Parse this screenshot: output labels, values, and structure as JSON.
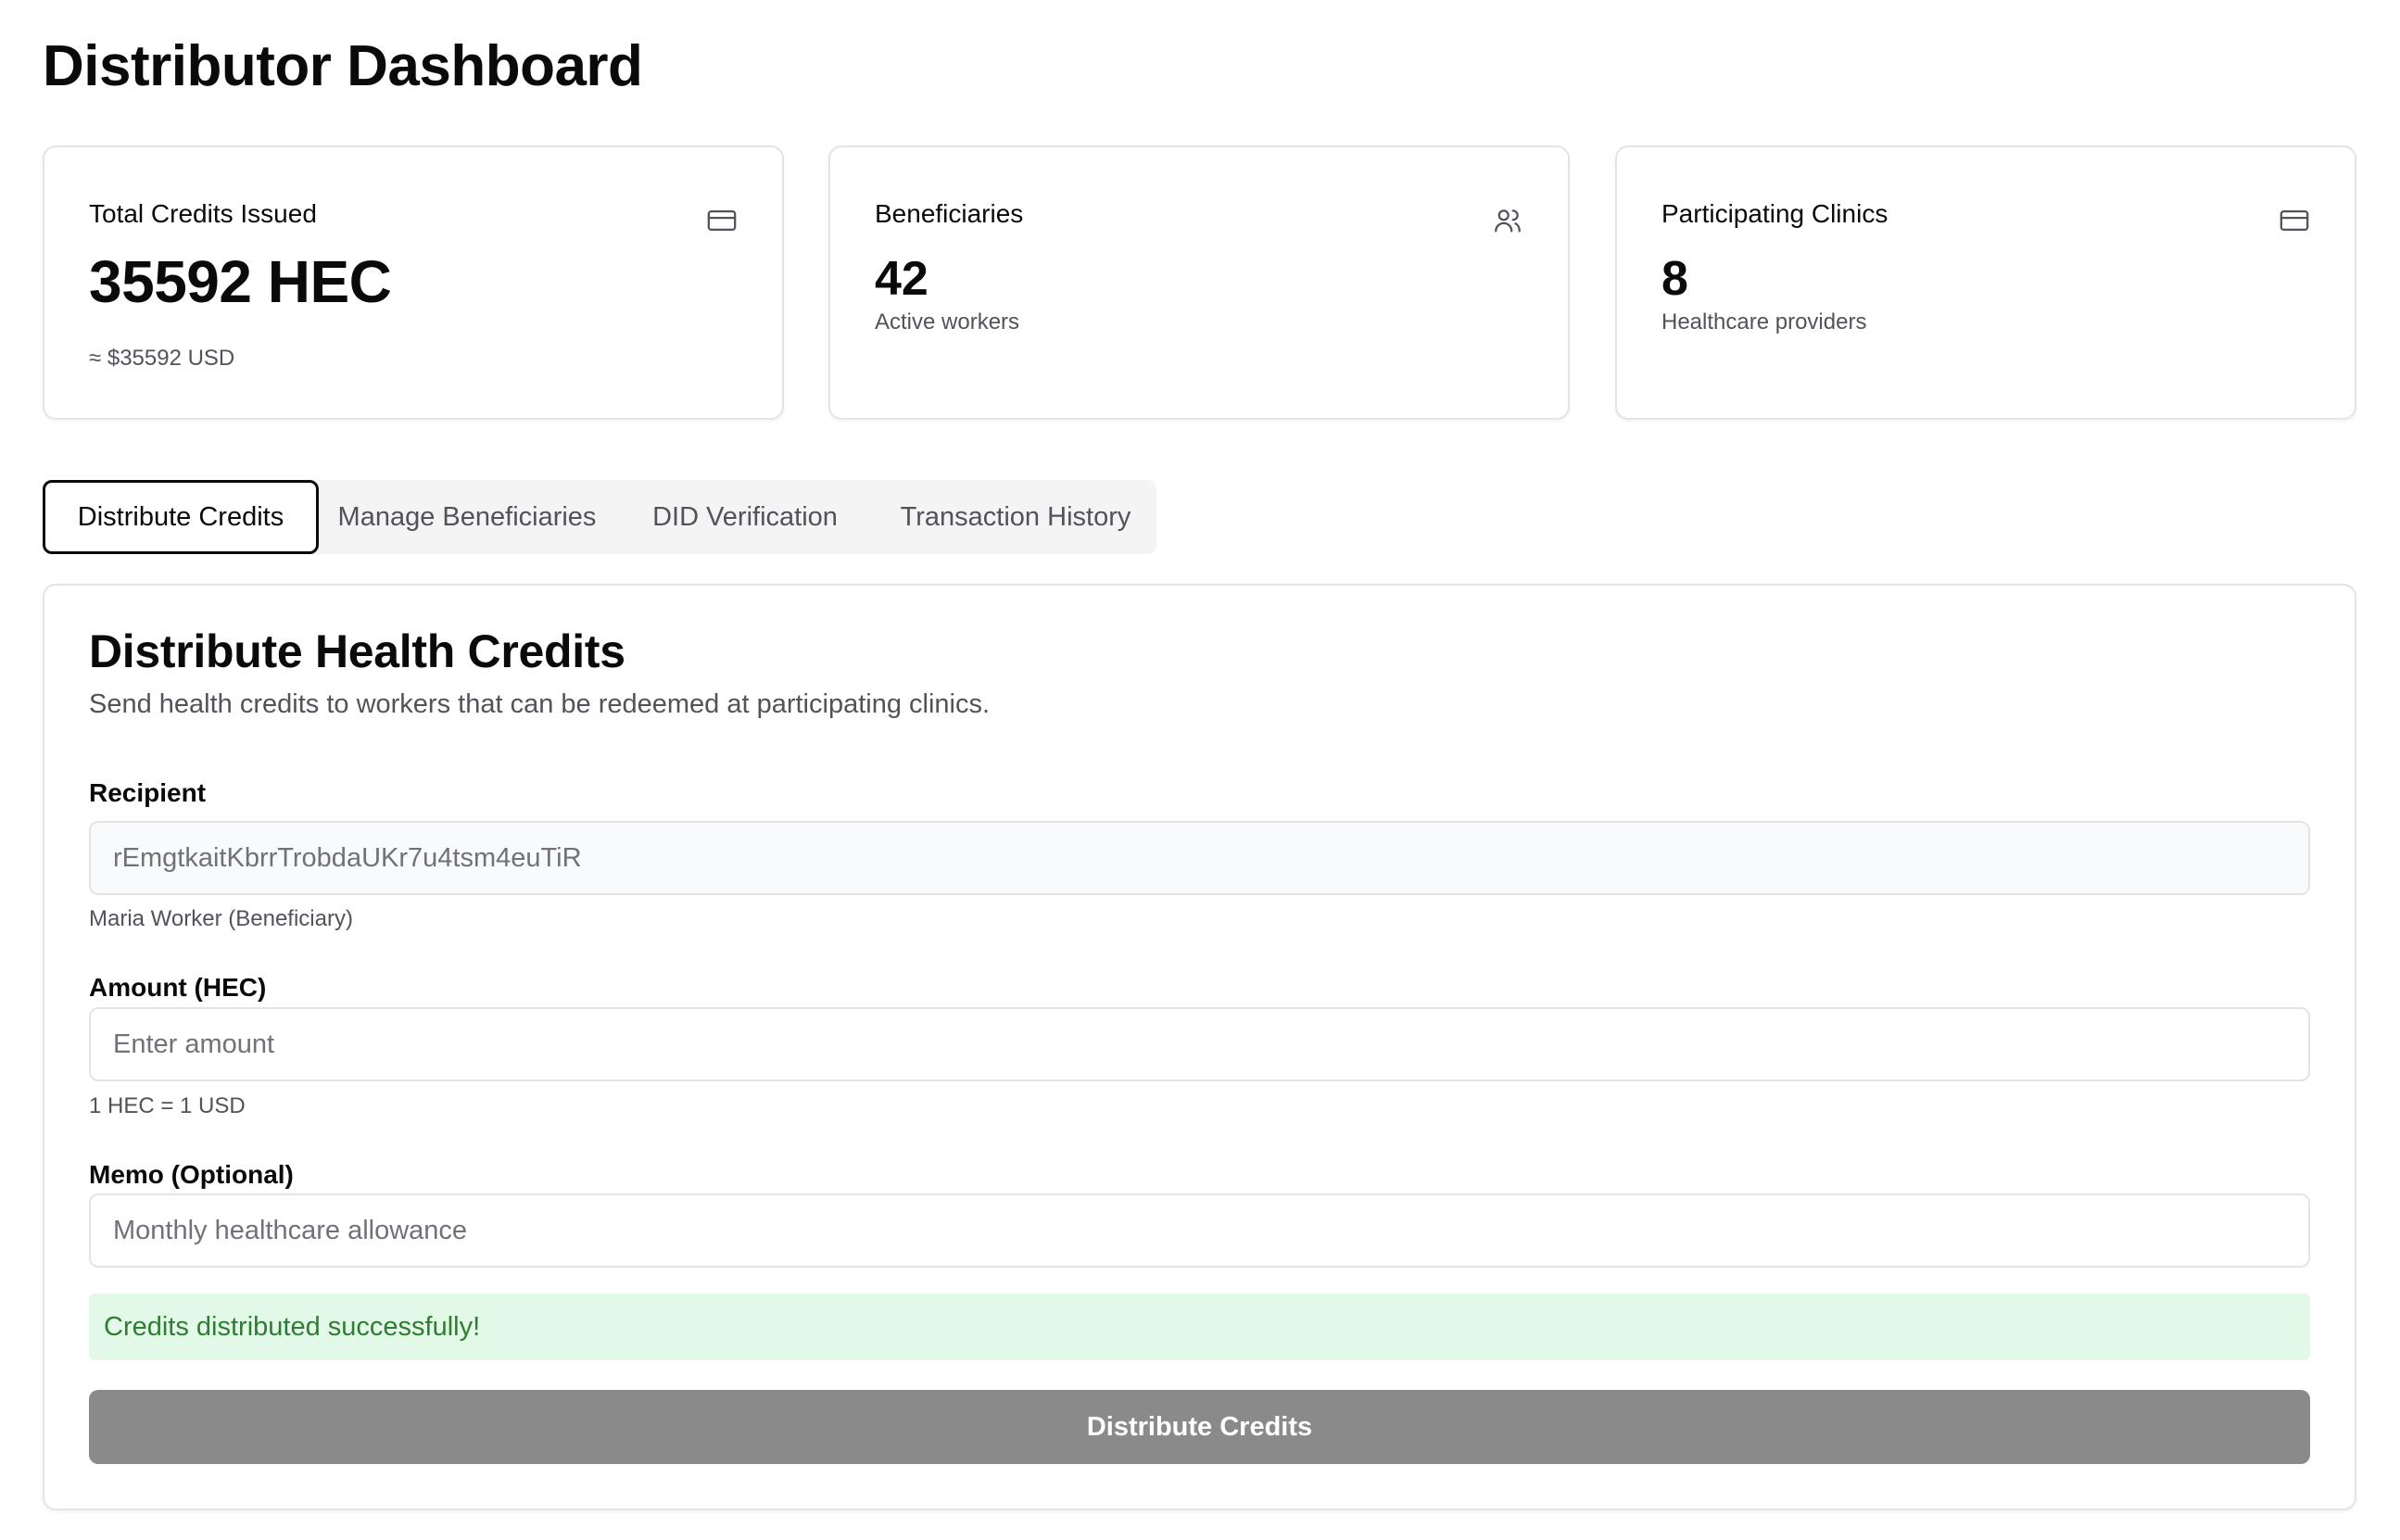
{
  "page_title": "Distributor Dashboard",
  "stats": {
    "credits": {
      "label": "Total Credits Issued",
      "value": "35592 HEC",
      "sub": "≈ $35592 USD",
      "icon": "credit-card-icon"
    },
    "beneficiaries": {
      "label": "Beneficiaries",
      "value": "42",
      "sub": "Active workers",
      "icon": "users-icon"
    },
    "clinics": {
      "label": "Participating Clinics",
      "value": "8",
      "sub": "Healthcare providers",
      "icon": "credit-card-icon"
    }
  },
  "tabs": [
    {
      "label": "Distribute Credits",
      "active": true
    },
    {
      "label": "Manage Beneficiaries",
      "active": false
    },
    {
      "label": "DID Verification",
      "active": false
    },
    {
      "label": "Transaction History",
      "active": false
    }
  ],
  "form": {
    "title": "Distribute Health Credits",
    "description": "Send health credits to workers that can be redeemed at participating clinics.",
    "recipient": {
      "label": "Recipient",
      "value": "rEmgtkaitKbrrTrobdaUKr7u4tsm4euTiR",
      "hint": "Maria Worker (Beneficiary)"
    },
    "amount": {
      "label": "Amount (HEC)",
      "placeholder": "Enter amount",
      "hint": "1 HEC = 1 USD"
    },
    "memo": {
      "label": "Memo (Optional)",
      "placeholder": "Monthly healthcare allowance"
    },
    "success_message": "Credits distributed successfully!",
    "submit_label": "Distribute Credits"
  },
  "colors": {
    "success_bg": "#e3f9e8",
    "success_text": "#2e7d32",
    "button_bg": "#8a8a8a",
    "border": "#e4e4e7"
  }
}
